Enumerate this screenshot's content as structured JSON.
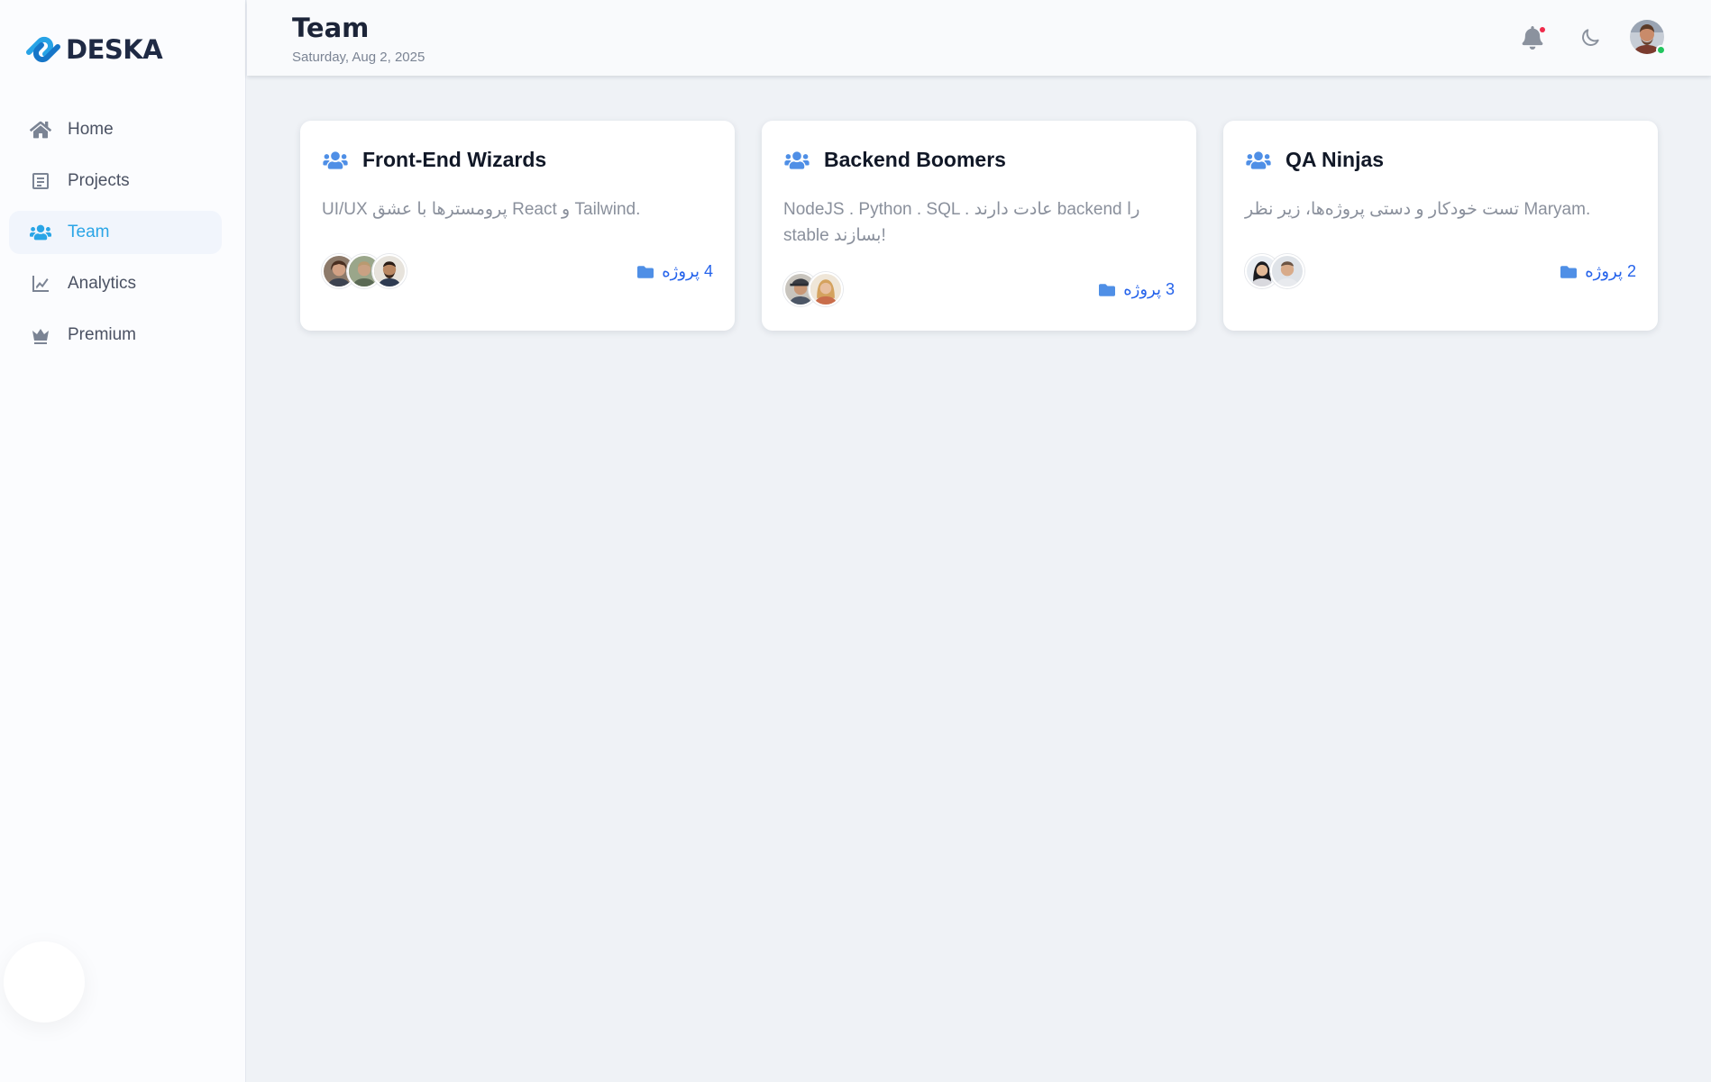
{
  "brand": {
    "name": "DESKA"
  },
  "sidebar": {
    "items": [
      {
        "label": "Home",
        "icon": "home-icon",
        "active": false
      },
      {
        "label": "Projects",
        "icon": "projects-icon",
        "active": false
      },
      {
        "label": "Team",
        "icon": "users-icon",
        "active": true
      },
      {
        "label": "Analytics",
        "icon": "chart-line-icon",
        "active": false
      },
      {
        "label": "Premium",
        "icon": "crown-icon",
        "active": false
      }
    ]
  },
  "header": {
    "title": "Team",
    "date": "Saturday, Aug 2, 2025",
    "icons": [
      "bell-icon",
      "moon-icon",
      "user-avatar"
    ]
  },
  "colors": {
    "accent": "#2aa5e6",
    "icon_blue": "#4f8fe6",
    "link_blue": "#2563eb",
    "notif": "#ef2b4b",
    "online": "#22c55e"
  },
  "teams": [
    {
      "name": "Front-End Wizards",
      "description": "UI/UX پرومسترها با عشق React و Tailwind.",
      "projects": "4 پروژه",
      "member_count": 3
    },
    {
      "name": "Backend Boomers",
      "description": "NodeJS . Python . SQL . عادت دارند backend را stable بسازند!",
      "projects": "3 پروژه",
      "member_count": 2
    },
    {
      "name": "QA Ninjas",
      "description": "تست خودکار و دستی پروژه‌ها، زیر نظر Maryam.",
      "projects": "2 پروژه",
      "member_count": 2
    }
  ]
}
